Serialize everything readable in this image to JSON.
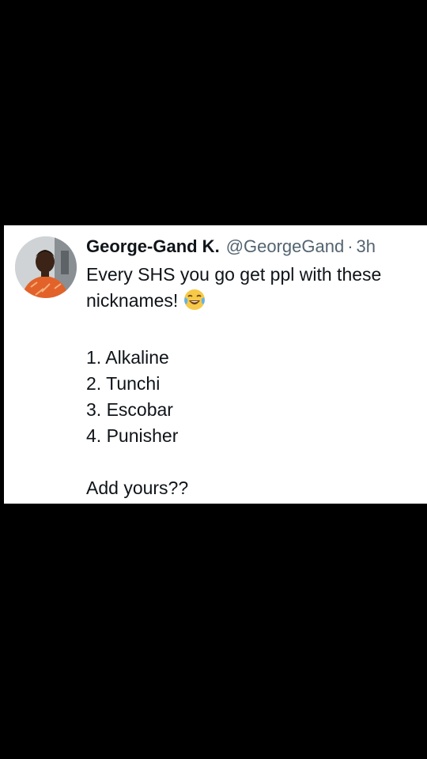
{
  "tweet": {
    "author_name": "George-Gand K.",
    "handle": "@GeorgeGand",
    "separator": "·",
    "time": "3h",
    "text_line1": "Every SHS you go get ppl with these",
    "text_line2": "nicknames!",
    "emoji": "face-with-tears-of-joy-icon",
    "list": [
      "1. Alkaline",
      "2. Tunchi",
      "3. Escobar",
      "4. Punisher"
    ],
    "outro": "Add yours??"
  },
  "colors": {
    "background": "#000000",
    "card": "#ffffff",
    "text": "#0f1419",
    "muted": "#536471"
  }
}
